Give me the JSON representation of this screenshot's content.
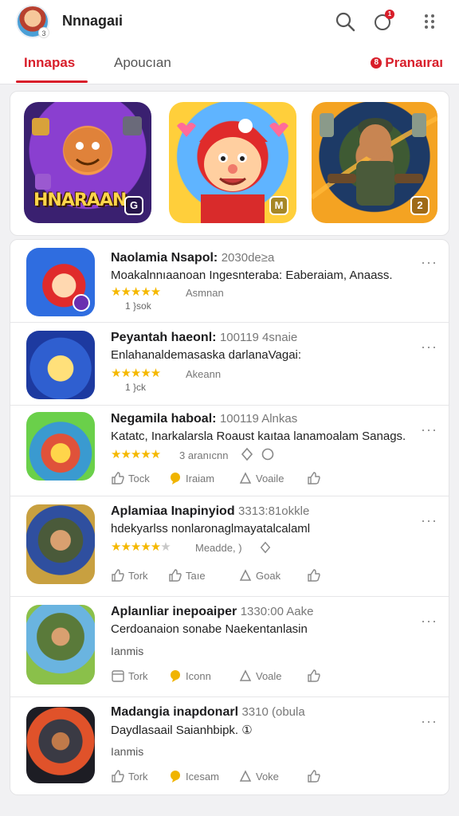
{
  "header": {
    "title": "Nnnagaıi",
    "notif_count": "1"
  },
  "tabs": {
    "active": "Innapas",
    "second": "Apoucıan",
    "right": "Pranaıraı",
    "right_dot": "8"
  },
  "featured": [
    {
      "label": "HNARAAN",
      "corner": "G",
      "icon": "game-art-monster-icon"
    },
    {
      "label": "",
      "corner": "M",
      "icon": "game-art-hero-icon"
    },
    {
      "label": "",
      "corner": "2",
      "icon": "game-art-soldier-icon"
    }
  ],
  "items": [
    {
      "title": "Naolamia Nsapol:",
      "meta": "2030de≥a",
      "desc": "Moakalnnıaanoan Ingesnteraba: Eaberaiam, Anaass.",
      "stars": 5,
      "rating_label": "Asmnan",
      "sub": "1 }sok",
      "extra": "",
      "actions": null
    },
    {
      "title": "Peyantah haeonl:",
      "meta": "100119 4snaie",
      "desc": "Enlahanaldemasaska darlanaVagai:",
      "stars": 5,
      "rating_label": "Akeann",
      "sub": "1 }ck",
      "extra": "",
      "actions": null
    },
    {
      "title": "Negamila haboal:",
      "meta": "100119 Alnkas",
      "desc": "Katatc, Inarkalarsla Roaust kaıtaa lanamoalam Sanags.",
      "stars": 5,
      "rating_label": "3 aranıcnn",
      "sub": "",
      "extra": "",
      "actions": {
        "like": "Tock",
        "comment": "Iraiam",
        "share": "Voaile",
        "save": ""
      }
    },
    {
      "title": "Aplamiaa Inapinyiod",
      "meta": "3313:81okkle",
      "desc": "hdekyarlss nonlaronaglmayatalcalaml",
      "stars": 4,
      "rating_label": "Meadde, )",
      "sub": "",
      "extra": "",
      "actions": {
        "like": "Tork",
        "comment": "Taıe",
        "share": "Goak",
        "save": ""
      }
    },
    {
      "title": "Aplaınliar inepoaiper",
      "meta": "1330:00 Aake",
      "desc": "Cerdoanaion sonabe Naekentanlasin",
      "stars": 0,
      "rating_label": "",
      "sub": "",
      "extra": "Ianmis",
      "actions": {
        "like": "Tork",
        "comment": "Iconn",
        "share": "Voale",
        "save": ""
      }
    },
    {
      "title": "Madangia inapdonarl",
      "meta": "3310 (obula",
      "desc": "Daydlasaail Saianhbipk. ①",
      "stars": 0,
      "rating_label": "",
      "sub": "",
      "extra": "Ianmis",
      "actions": {
        "like": "Tork",
        "comment": "Icesam",
        "share": "Voke",
        "save": ""
      }
    }
  ],
  "more_label": "···"
}
